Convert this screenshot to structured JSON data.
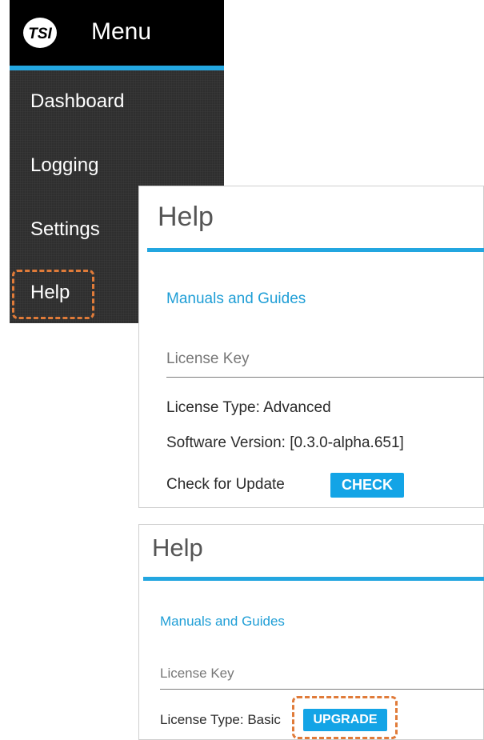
{
  "menu": {
    "title": "Menu",
    "items": [
      {
        "label": "Dashboard"
      },
      {
        "label": "Logging"
      },
      {
        "label": "Settings"
      },
      {
        "label": "Help"
      }
    ],
    "accent_color": "#23a6e0",
    "highlight_color": "#e07b39"
  },
  "help_panel_advanced": {
    "title": "Help",
    "manuals_link": "Manuals and Guides",
    "license_key_placeholder": "License Key",
    "license_type": "License Type: Advanced",
    "software_version": "Software Version: [0.3.0-alpha.651]",
    "check_update_label": "Check for Update",
    "check_button": "CHECK"
  },
  "help_panel_basic": {
    "title": "Help",
    "manuals_link": "Manuals and Guides",
    "license_key_placeholder": "License Key",
    "license_type": "License Type: Basic",
    "upgrade_button": "UPGRADE"
  }
}
